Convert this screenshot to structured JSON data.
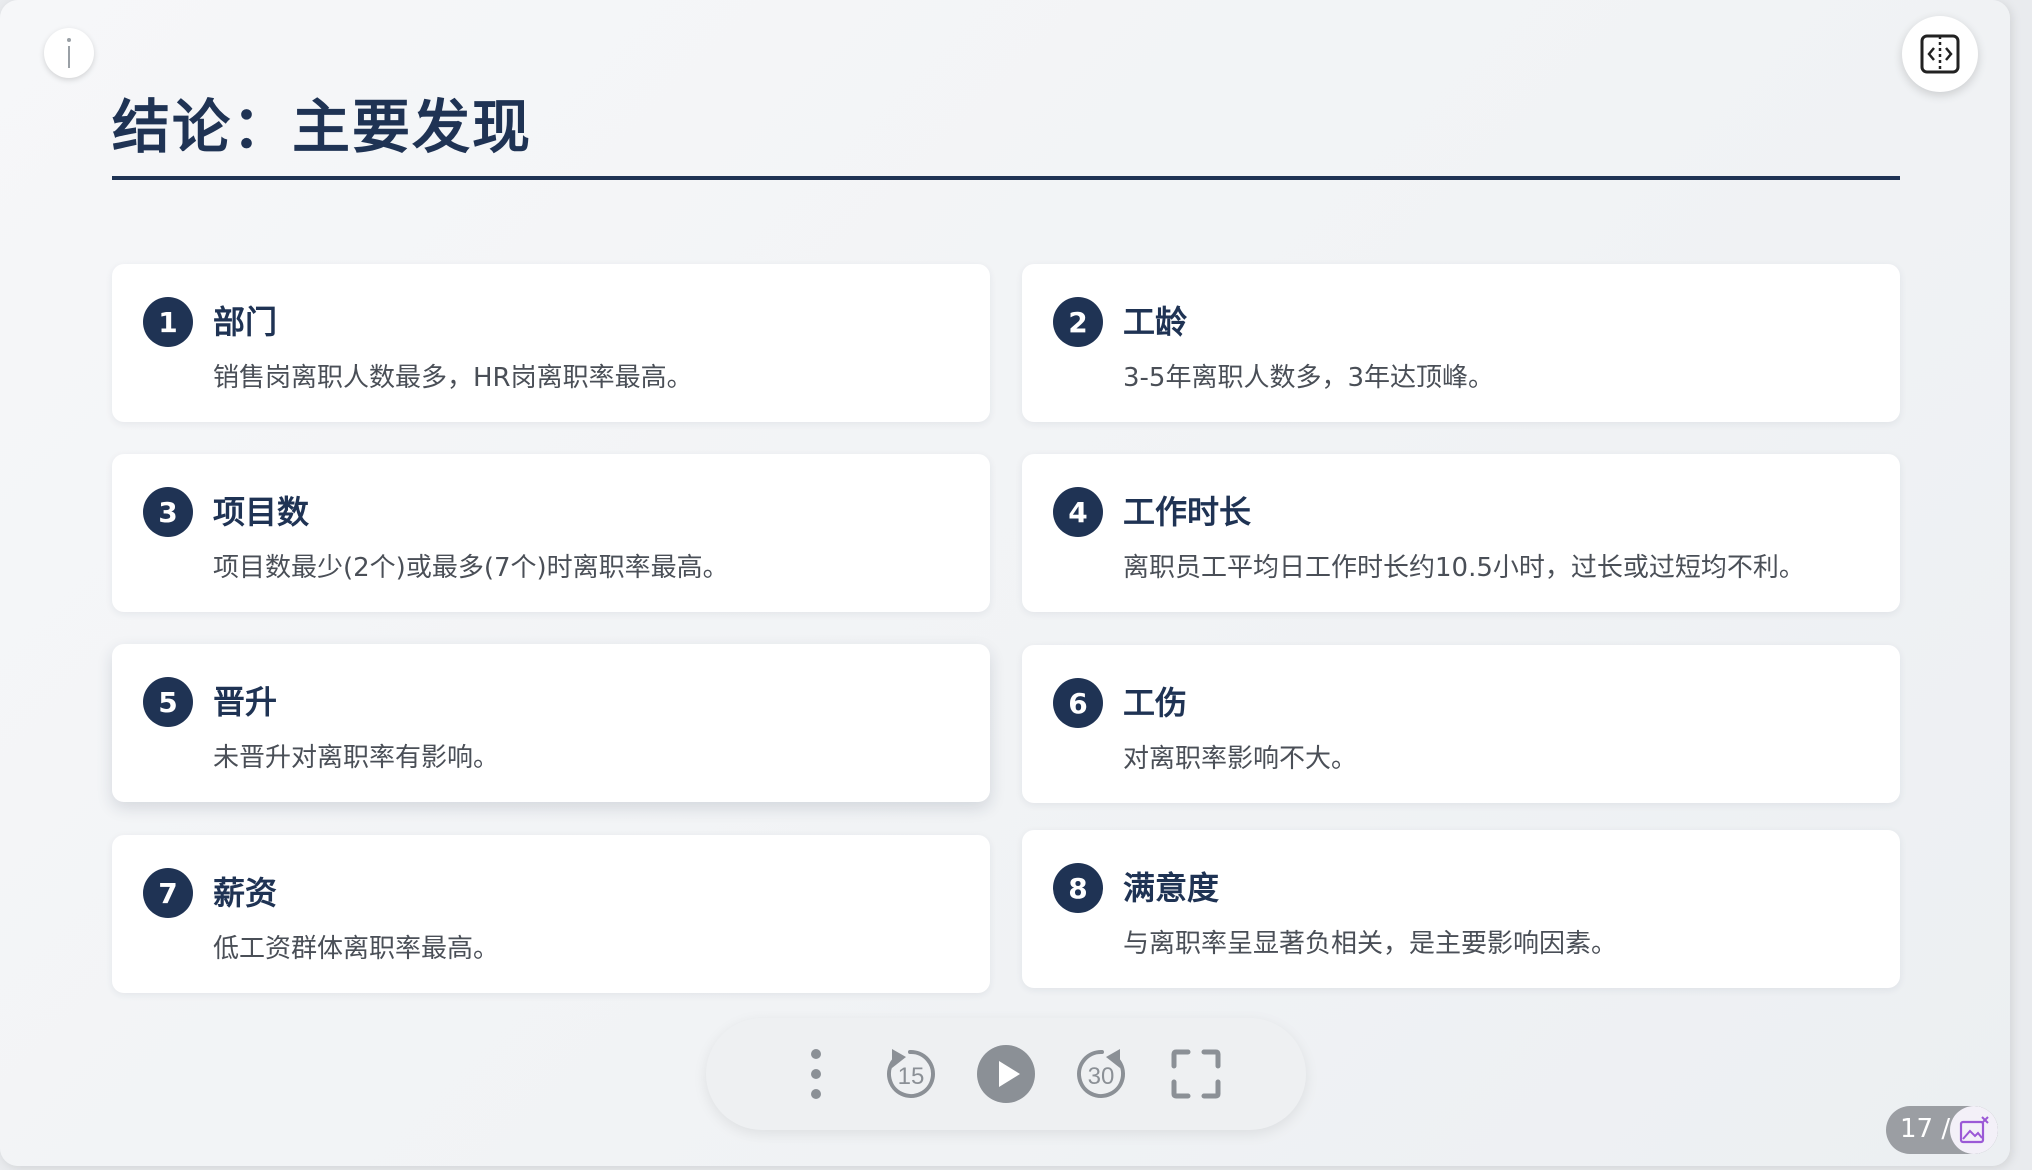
{
  "slide": {
    "title": "结论：主要发现"
  },
  "findings": [
    {
      "number": "1",
      "title": "部门",
      "description": "销售岗离职人数最多，HR岗离职率最高。"
    },
    {
      "number": "2",
      "title": "工龄",
      "description": "3-5年离职人数多，3年达顶峰。"
    },
    {
      "number": "3",
      "title": "项目数",
      "description": "项目数最少(2个)或最多(7个)时离职率最高。"
    },
    {
      "number": "4",
      "title": "工作时长",
      "description": "离职员工平均日工作时长约10.5小时，过长或过短均不利。"
    },
    {
      "number": "5",
      "title": "晋升",
      "description": "未晋升对离职率有影响。"
    },
    {
      "number": "6",
      "title": "工伤",
      "description": "对离职率影响不大。"
    },
    {
      "number": "7",
      "title": "薪资",
      "description": "低工资群体离职率最高。"
    },
    {
      "number": "8",
      "title": "满意度",
      "description": "与离职率呈显著负相关，是主要影响因素。"
    }
  ],
  "player": {
    "rewind_label": "15",
    "forward_label": "30"
  },
  "pagination": {
    "text": "17 /"
  },
  "icons": {
    "info": "info-icon",
    "split_view": "split-view-icon",
    "more": "more-vertical-icon",
    "rewind": "rewind-15-icon",
    "play": "play-icon",
    "forward": "forward-30-icon",
    "fullscreen": "fullscreen-icon",
    "page_image": "image-edit-icon"
  },
  "colors": {
    "accent": "#1f3354",
    "card_bg": "#ffffff",
    "body_text": "#4a4f57",
    "control_icon": "#8b9096",
    "page_icon": "#9b59d6"
  }
}
